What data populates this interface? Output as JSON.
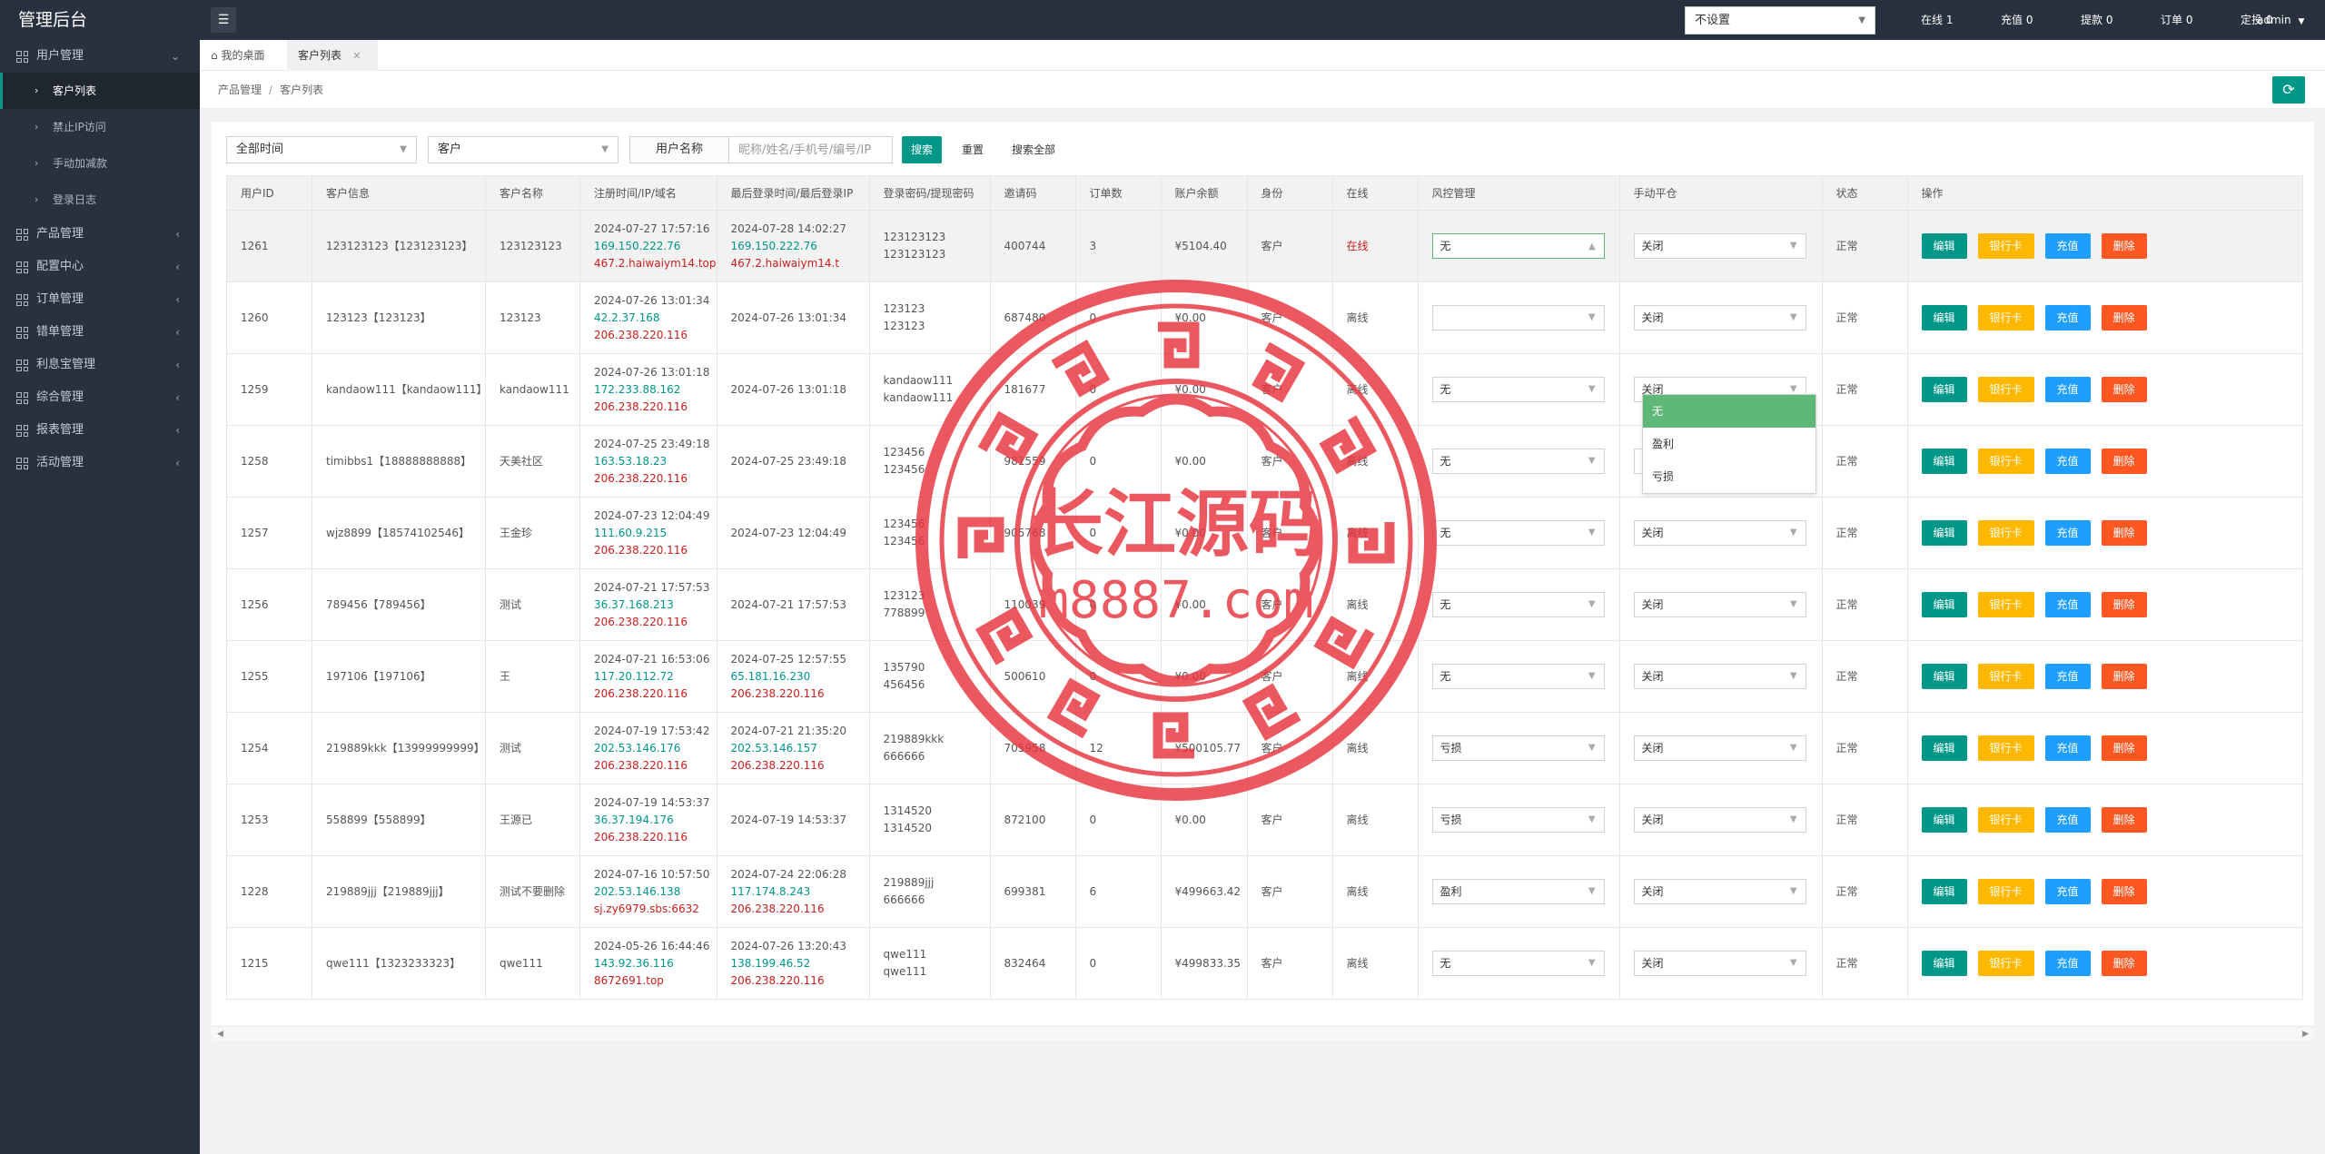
{
  "sidebar": {
    "logo": "管理后台",
    "sections": [
      {
        "label": "用户管理",
        "icon": "grid-icon",
        "expanded": true,
        "children": [
          {
            "label": "客户列表",
            "active": true
          },
          {
            "label": "禁止IP访问"
          },
          {
            "label": "手动加减款"
          },
          {
            "label": "登录日志"
          }
        ]
      },
      {
        "label": "产品管理",
        "icon": "grid-icon"
      },
      {
        "label": "配置中心",
        "icon": "grid-icon"
      },
      {
        "label": "订单管理",
        "icon": "grid-icon"
      },
      {
        "label": "错单管理",
        "icon": "grid-icon"
      },
      {
        "label": "利息宝管理",
        "icon": "grid-icon"
      },
      {
        "label": "综合管理",
        "icon": "grid-icon"
      },
      {
        "label": "报表管理",
        "icon": "grid-icon"
      },
      {
        "label": "活动管理",
        "icon": "grid-icon"
      }
    ]
  },
  "topbar": {
    "menu_icon": "hamburger-icon",
    "select_value": "不设置",
    "stats": [
      "在线 1",
      "充值 0",
      "提款 0",
      "订单 0",
      "定投 0"
    ],
    "user": "admin"
  },
  "tabs": [
    {
      "label": "我的桌面",
      "icon": "home-icon"
    },
    {
      "label": "客户列表",
      "active": true,
      "closable": true
    }
  ],
  "breadcrumb": [
    "产品管理",
    "客户列表"
  ],
  "refresh_icon": "refresh-icon",
  "filters": {
    "time_select": "全部时间",
    "type_select": "客户",
    "name_label": "用户名称",
    "name_placeholder": "昵称/姓名/手机号/编号/IP",
    "search_btn": "搜索",
    "reset_btn": "重置",
    "search_all_btn": "搜索全部"
  },
  "table": {
    "headers": [
      "用户ID",
      "客户信息",
      "客户名称",
      "注册时间/IP/域名",
      "最后登录时间/最后登录IP",
      "登录密码/提现密码",
      "邀请码",
      "订单数",
      "账户余额",
      "身份",
      "在线",
      "风控管理",
      "手动平仓",
      "状态",
      "操作"
    ],
    "actions": [
      "编辑",
      "银行卡",
      "充值",
      "删除"
    ],
    "rows": [
      {
        "id": "1261",
        "info": "123123123【123123123】",
        "name": "123123123",
        "reg_time": "2024-07-27 17:57:16",
        "reg_ip": "169.150.222.76",
        "reg_domain": "467.2.haiwaiym14.top",
        "last_time": "2024-07-28 14:02:27",
        "last_ip": "169.150.222.76",
        "last_ip2": "467.2.haiwaiym14.t",
        "pwd1": "123123123",
        "pwd2": "123123123",
        "invite": "400744",
        "orders": "3",
        "balance": "¥5104.40",
        "role": "客户",
        "online": "在线",
        "risk": "无",
        "close": "关闭",
        "status": "正常"
      },
      {
        "id": "1260",
        "info": "123123【123123】",
        "name": "123123",
        "reg_time": "2024-07-26 13:01:34",
        "reg_ip": "42.2.37.168",
        "reg_domain": "206.238.220.116",
        "last_time": "2024-07-26 13:01:34",
        "last_ip": "",
        "last_ip2": "",
        "pwd1": "123123",
        "pwd2": "123123",
        "invite": "687480",
        "orders": "0",
        "balance": "¥0.00",
        "role": "客户",
        "online": "离线",
        "risk": "",
        "close": "关闭",
        "status": "正常"
      },
      {
        "id": "1259",
        "info": "kandaow111【kandaow111】",
        "name": "kandaow111",
        "reg_time": "2024-07-26 13:01:18",
        "reg_ip": "172.233.88.162",
        "reg_domain": "206.238.220.116",
        "last_time": "2024-07-26 13:01:18",
        "last_ip": "",
        "last_ip2": "",
        "pwd1": "kandaow111",
        "pwd2": "kandaow111",
        "invite": "181677",
        "orders": "0",
        "balance": "¥0.00",
        "role": "客户",
        "online": "离线",
        "risk": "无",
        "close": "关闭",
        "status": "正常"
      },
      {
        "id": "1258",
        "info": "timibbs1【18888888888】",
        "name": "天美社区",
        "reg_time": "2024-07-25 23:49:18",
        "reg_ip": "163.53.18.23",
        "reg_domain": "206.238.220.116",
        "last_time": "2024-07-25 23:49:18",
        "last_ip": "",
        "last_ip2": "",
        "pwd1": "123456",
        "pwd2": "123456",
        "invite": "981559",
        "orders": "0",
        "balance": "¥0.00",
        "role": "客户",
        "online": "离线",
        "risk": "无",
        "close": "关闭",
        "status": "正常"
      },
      {
        "id": "1257",
        "info": "wjz8899【18574102546】",
        "name": "王金珍",
        "reg_time": "2024-07-23 12:04:49",
        "reg_ip": "111.60.9.215",
        "reg_domain": "206.238.220.116",
        "last_time": "2024-07-23 12:04:49",
        "last_ip": "",
        "last_ip2": "",
        "pwd1": "123456",
        "pwd2": "123456",
        "invite": "905768",
        "orders": "0",
        "balance": "¥0.00",
        "role": "客户",
        "online": "离线",
        "risk": "无",
        "close": "关闭",
        "status": "正常"
      },
      {
        "id": "1256",
        "info": "789456【789456】",
        "name": "测试",
        "reg_time": "2024-07-21 17:57:53",
        "reg_ip": "36.37.168.213",
        "reg_domain": "206.238.220.116",
        "last_time": "2024-07-21 17:57:53",
        "last_ip": "",
        "last_ip2": "",
        "pwd1": "123123",
        "pwd2": "778899",
        "invite": "110039",
        "orders": "0",
        "balance": "¥0.00",
        "role": "客户",
        "online": "离线",
        "risk": "无",
        "close": "关闭",
        "status": "正常"
      },
      {
        "id": "1255",
        "info": "197106【197106】",
        "name": "王",
        "reg_time": "2024-07-21 16:53:06",
        "reg_ip": "117.20.112.72",
        "reg_domain": "206.238.220.116",
        "last_time": "2024-07-25 12:57:55",
        "last_ip": "65.181.16.230",
        "last_ip2": "206.238.220.116",
        "pwd1": "135790",
        "pwd2": "456456",
        "invite": "500610",
        "orders": "0",
        "balance": "¥0.00",
        "role": "客户",
        "online": "离线",
        "risk": "无",
        "close": "关闭",
        "status": "正常"
      },
      {
        "id": "1254",
        "info": "219889kkk【13999999999】",
        "name": "测试",
        "reg_time": "2024-07-19 17:53:42",
        "reg_ip": "202.53.146.176",
        "reg_domain": "206.238.220.116",
        "last_time": "2024-07-21 21:35:20",
        "last_ip": "202.53.146.157",
        "last_ip2": "206.238.220.116",
        "pwd1": "219889kkk",
        "pwd2": "666666",
        "invite": "705958",
        "orders": "12",
        "balance": "¥500105.77",
        "role": "客户",
        "online": "离线",
        "risk": "亏损",
        "close": "关闭",
        "status": "正常"
      },
      {
        "id": "1253",
        "info": "558899【558899】",
        "name": "王源已",
        "reg_time": "2024-07-19 14:53:37",
        "reg_ip": "36.37.194.176",
        "reg_domain": "206.238.220.116",
        "last_time": "2024-07-19 14:53:37",
        "last_ip": "",
        "last_ip2": "",
        "pwd1": "1314520",
        "pwd2": "1314520",
        "invite": "872100",
        "orders": "0",
        "balance": "¥0.00",
        "role": "客户",
        "online": "离线",
        "risk": "亏损",
        "close": "关闭",
        "status": "正常"
      },
      {
        "id": "1228",
        "info": "219889jjj【219889jjj】",
        "name": "测试不要删除",
        "reg_time": "2024-07-16 10:57:50",
        "reg_ip": "202.53.146.138",
        "reg_domain": "sj.zy6979.sbs:6632",
        "last_time": "2024-07-24 22:06:28",
        "last_ip": "117.174.8.243",
        "last_ip2": "206.238.220.116",
        "pwd1": "219889jjj",
        "pwd2": "666666",
        "invite": "699381",
        "orders": "6",
        "balance": "¥499663.42",
        "role": "客户",
        "online": "离线",
        "risk": "盈利",
        "close": "关闭",
        "status": "正常"
      },
      {
        "id": "1215",
        "info": "qwe111【1323233323】",
        "name": "qwe111",
        "reg_time": "2024-05-26 16:44:46",
        "reg_ip": "143.92.36.116",
        "reg_domain": "8672691.top",
        "last_time": "2024-07-26 13:20:43",
        "last_ip": "138.199.46.52",
        "last_ip2": "206.238.220.116",
        "pwd1": "qwe111",
        "pwd2": "qwe111",
        "invite": "832464",
        "orders": "0",
        "balance": "¥499833.35",
        "role": "客户",
        "online": "离线",
        "risk": "无",
        "close": "关闭",
        "status": "正常"
      }
    ]
  },
  "risk_dropdown": {
    "options": [
      "无",
      "盈利",
      "亏损"
    ],
    "selected": "无"
  },
  "watermark": {
    "line1": "长江源码",
    "line2": "m8887.com",
    "color": "#e8343e"
  }
}
